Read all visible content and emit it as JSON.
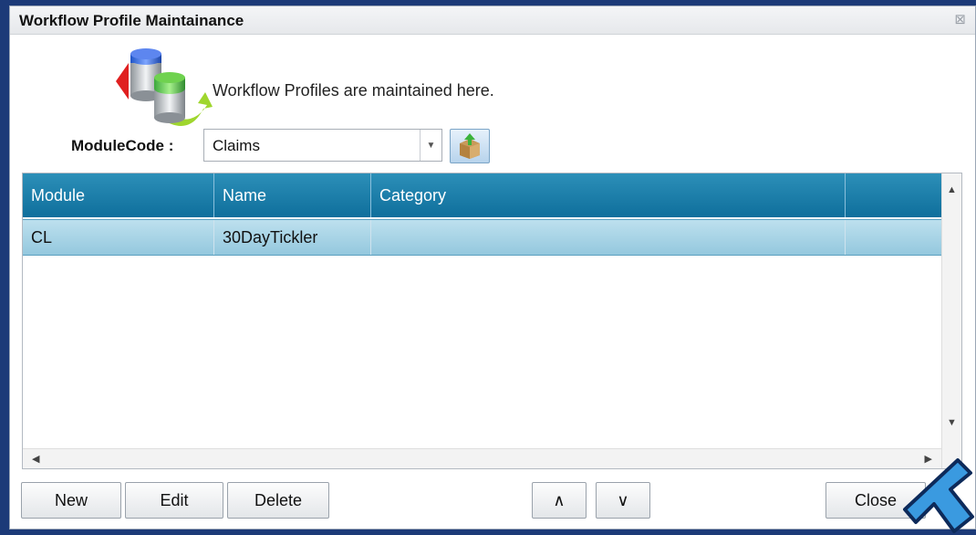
{
  "window": {
    "title": "Workflow Profile Maintainance",
    "close_symbol": "⊠"
  },
  "header": {
    "text": "Workflow Profiles are maintained here."
  },
  "module_code": {
    "label": "ModuleCode :",
    "selected": "Claims",
    "dropdown_symbol": "▼"
  },
  "grid": {
    "columns": [
      "Module",
      "Name",
      "Category",
      ""
    ],
    "rows": [
      {
        "module": "CL",
        "name": "30DayTickler",
        "category": ""
      }
    ]
  },
  "scrollbar": {
    "up": "▲",
    "down": "▼",
    "left": "◀",
    "right": "▶"
  },
  "buttons": {
    "new": "New",
    "edit": "Edit",
    "delete": "Delete",
    "move_up": "∧",
    "move_down": "∨",
    "close": "Close"
  },
  "colors": {
    "header_bg": "#1a7fab",
    "selected_row": "#a8d4e6",
    "pointer_arrow": "#3a9ae0"
  },
  "icons": {
    "logo": "database-sync-icon",
    "package": "package-icon",
    "pointer": "pointer-arrow-icon"
  }
}
